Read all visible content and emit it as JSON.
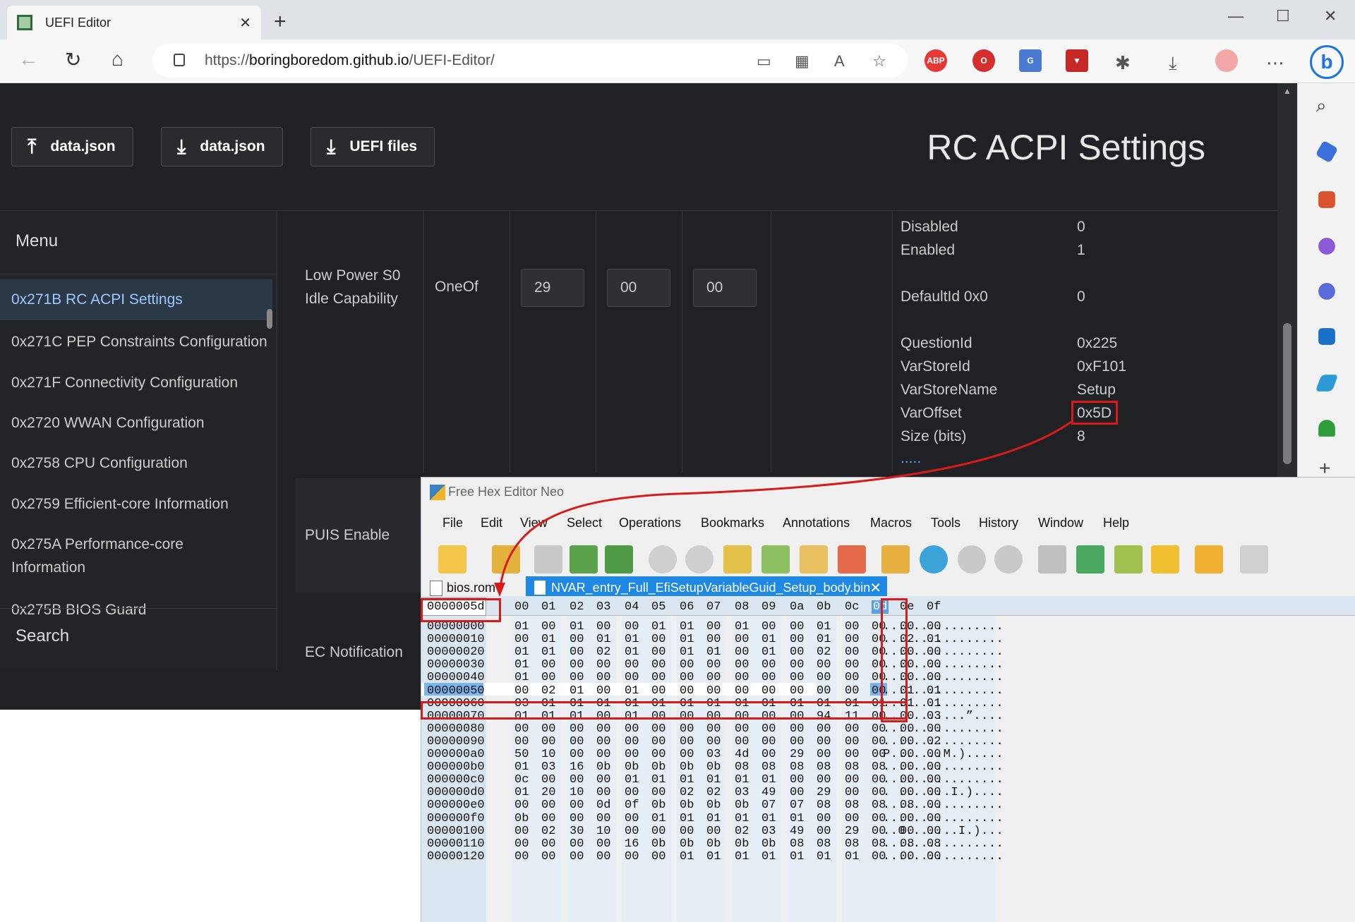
{
  "browser": {
    "tab_title": "UEFI Editor",
    "url_prefix": "https://",
    "url_host": "boringboredom.github.io",
    "url_path": "/UEFI-Editor/",
    "extensions": [
      "ABP"
    ]
  },
  "page": {
    "buttons": [
      {
        "label": "data.json",
        "icon": "upload-icon"
      },
      {
        "label": "data.json",
        "icon": "download-icon"
      },
      {
        "label": "UEFI files",
        "icon": "download-icon"
      }
    ],
    "title": "RC ACPI Settings"
  },
  "menu": {
    "heading": "Menu",
    "items": [
      "0x271B RC ACPI Settings",
      "0x271C PEP Constraints Configuration",
      "0x271F Connectivity Configuration",
      "0x2720 WWAN Configuration",
      "0x2758 CPU Configuration",
      "0x2759 Efficient-core Information",
      "0x275A Performance-core",
      "Information",
      "0x275B BIOS Guard"
    ],
    "search": "Search"
  },
  "settings": {
    "row1": {
      "label_line1": "Low Power S0",
      "label_line2": "Idle Capability",
      "type": "OneOf",
      "values": [
        "29",
        "00",
        "00"
      ]
    },
    "row2_label": "PUIS Enable",
    "row3_label": "EC Notification"
  },
  "properties": [
    {
      "key": "Disabled",
      "value": "0"
    },
    {
      "key": "Enabled",
      "value": "1"
    },
    {
      "key": "DefaultId 0x0",
      "value": "0"
    },
    {
      "key": "QuestionId",
      "value": "0x225"
    },
    {
      "key": "VarStoreId",
      "value": "0xF101"
    },
    {
      "key": "VarStoreName",
      "value": "Setup"
    },
    {
      "key": "VarOffset",
      "value": "0x5D"
    },
    {
      "key": "Size (bits)",
      "value": "8"
    },
    {
      "key": ".....",
      "value": ""
    }
  ],
  "hex_editor": {
    "title": "Free Hex Editor Neo",
    "menu": [
      "File",
      "Edit",
      "View",
      "Select",
      "Operations",
      "Bookmarks",
      "Annotations",
      "Macros",
      "Tools",
      "History",
      "Window",
      "Help"
    ],
    "tabs": [
      "bios.rom",
      "NVAR_entry_Full_EfiSetupVariableGuid_Setup_body.bin"
    ],
    "current_offset": "0000005d",
    "columns": [
      "00",
      "01",
      "02",
      "03",
      "04",
      "05",
      "06",
      "07",
      "08",
      "09",
      "0a",
      "0b",
      "0c",
      "0d",
      "0e",
      "0f"
    ],
    "rows": [
      {
        "off": "00000000",
        "bytes": [
          "01",
          "00",
          "01",
          "00",
          "00",
          "01",
          "01",
          "00",
          "01",
          "00",
          "00",
          "01",
          "00",
          "00",
          "00",
          "00"
        ],
        "ascii": "................"
      },
      {
        "off": "00000010",
        "bytes": [
          "00",
          "01",
          "00",
          "01",
          "01",
          "00",
          "01",
          "00",
          "00",
          "01",
          "00",
          "01",
          "00",
          "00",
          "02",
          "01"
        ],
        "ascii": "................"
      },
      {
        "off": "00000020",
        "bytes": [
          "01",
          "01",
          "00",
          "02",
          "01",
          "00",
          "01",
          "01",
          "00",
          "01",
          "00",
          "02",
          "00",
          "00",
          "00",
          "00"
        ],
        "ascii": "................"
      },
      {
        "off": "00000030",
        "bytes": [
          "01",
          "00",
          "00",
          "00",
          "00",
          "00",
          "00",
          "00",
          "00",
          "00",
          "00",
          "00",
          "00",
          "00",
          "00",
          "00"
        ],
        "ascii": "................"
      },
      {
        "off": "00000040",
        "bytes": [
          "01",
          "00",
          "00",
          "00",
          "00",
          "00",
          "00",
          "00",
          "00",
          "00",
          "00",
          "00",
          "00",
          "00",
          "00",
          "00"
        ],
        "ascii": "................"
      },
      {
        "off": "00000050",
        "bytes": [
          "00",
          "02",
          "01",
          "00",
          "01",
          "00",
          "00",
          "00",
          "00",
          "00",
          "00",
          "00",
          "00",
          "00",
          "01",
          "01"
        ],
        "ascii": "................"
      },
      {
        "off": "00000060",
        "bytes": [
          "03",
          "01",
          "01",
          "01",
          "01",
          "01",
          "01",
          "01",
          "01",
          "01",
          "01",
          "01",
          "01",
          "01",
          "01",
          "01"
        ],
        "ascii": "................"
      },
      {
        "off": "00000070",
        "bytes": [
          "01",
          "01",
          "01",
          "00",
          "01",
          "00",
          "00",
          "00",
          "00",
          "00",
          "00",
          "94",
          "11",
          "00",
          "00",
          "03"
        ],
        "ascii": "...........”...."
      },
      {
        "off": "00000080",
        "bytes": [
          "00",
          "00",
          "00",
          "00",
          "00",
          "00",
          "00",
          "00",
          "00",
          "00",
          "00",
          "00",
          "00",
          "00",
          "00",
          "00"
        ],
        "ascii": "................"
      },
      {
        "off": "00000090",
        "bytes": [
          "00",
          "00",
          "00",
          "00",
          "00",
          "00",
          "00",
          "00",
          "00",
          "00",
          "00",
          "00",
          "00",
          "00",
          "00",
          "02"
        ],
        "ascii": "................"
      },
      {
        "off": "000000a0",
        "bytes": [
          "50",
          "10",
          "00",
          "00",
          "00",
          "00",
          "00",
          "03",
          "4d",
          "00",
          "29",
          "00",
          "00",
          "00",
          "00",
          "00"
        ],
        "ascii": "P.......M.)....."
      },
      {
        "off": "000000b0",
        "bytes": [
          "01",
          "03",
          "16",
          "0b",
          "0b",
          "0b",
          "0b",
          "0b",
          "08",
          "08",
          "08",
          "08",
          "08",
          "08",
          "00",
          "00"
        ],
        "ascii": "................"
      },
      {
        "off": "000000c0",
        "bytes": [
          "0c",
          "00",
          "00",
          "00",
          "01",
          "01",
          "01",
          "01",
          "01",
          "01",
          "00",
          "00",
          "00",
          "00",
          "00",
          "00"
        ],
        "ascii": "................"
      },
      {
        "off": "000000d0",
        "bytes": [
          "01",
          "20",
          "10",
          "00",
          "00",
          "00",
          "02",
          "02",
          "03",
          "49",
          "00",
          "29",
          "00",
          "00",
          "00",
          "00"
        ],
        "ascii": ". .......I.)...."
      },
      {
        "off": "000000e0",
        "bytes": [
          "00",
          "00",
          "00",
          "0d",
          "0f",
          "0b",
          "0b",
          "0b",
          "0b",
          "07",
          "07",
          "08",
          "08",
          "08",
          "08",
          "00"
        ],
        "ascii": "................"
      },
      {
        "off": "000000f0",
        "bytes": [
          "0b",
          "00",
          "00",
          "00",
          "00",
          "01",
          "01",
          "01",
          "01",
          "01",
          "01",
          "00",
          "00",
          "00",
          "00",
          "00"
        ],
        "ascii": "................"
      },
      {
        "off": "00000100",
        "bytes": [
          "00",
          "02",
          "30",
          "10",
          "00",
          "00",
          "00",
          "00",
          "02",
          "03",
          "49",
          "00",
          "29",
          "00",
          "00",
          "00"
        ],
        "ascii": "..0.......I.)..."
      },
      {
        "off": "00000110",
        "bytes": [
          "00",
          "00",
          "00",
          "00",
          "16",
          "0b",
          "0b",
          "0b",
          "0b",
          "0b",
          "08",
          "08",
          "08",
          "08",
          "08",
          "08"
        ],
        "ascii": "................"
      },
      {
        "off": "00000120",
        "bytes": [
          "00",
          "00",
          "00",
          "00",
          "00",
          "00",
          "01",
          "01",
          "01",
          "01",
          "01",
          "01",
          "01",
          "00",
          "00",
          "00"
        ],
        "ascii": "................"
      }
    ]
  }
}
